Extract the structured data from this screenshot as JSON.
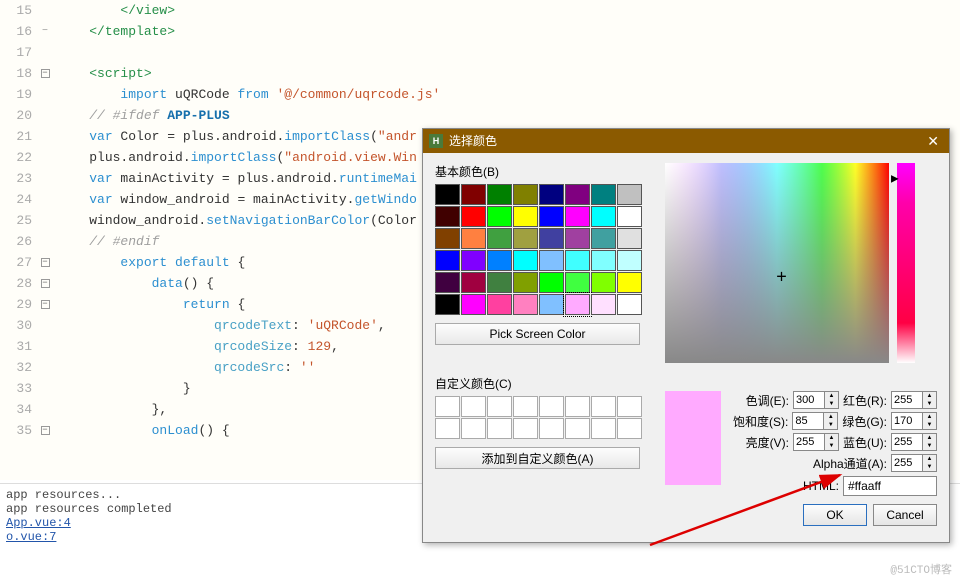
{
  "lines": [
    "15",
    "16",
    "17",
    "18",
    "19",
    "20",
    "21",
    "22",
    "23",
    "24",
    "25",
    "26",
    "27",
    "28",
    "29",
    "30",
    "31",
    "32",
    "33",
    "34",
    "35"
  ],
  "folds": [
    "",
    "−",
    "",
    "□",
    "",
    "",
    "",
    "",
    "",
    "",
    "",
    "",
    "□",
    "□",
    "□",
    "",
    "",
    "",
    "",
    "",
    "□"
  ],
  "code": {
    "l15": {
      "indent": "        ",
      "tag": "</view>"
    },
    "l16": {
      "indent": "    ",
      "tag": "</template>"
    },
    "l18": {
      "indent": "    ",
      "tag": "<script>"
    },
    "l19": {
      "indent": "        ",
      "kw": "import",
      "id": " uQRCode ",
      "kw2": "from",
      "str": " '@/common/uqrcode.js'"
    },
    "l20": {
      "indent": "    ",
      "cmt": "// #ifdef ",
      "strong": "APP-PLUS"
    },
    "l21": {
      "indent": "    ",
      "kw": "var",
      "id": " Color = plus.android.",
      "fn": "importClass",
      "paren": "(",
      "str": "\"andr"
    },
    "l22": {
      "indent": "    ",
      "id": "plus.android.",
      "fn": "importClass",
      "paren": "(",
      "str": "\"android.view.Win"
    },
    "l23": {
      "indent": "    ",
      "kw": "var",
      "id": " mainActivity = plus.android.",
      "fn": "runtimeMai"
    },
    "l24": {
      "indent": "    ",
      "kw": "var",
      "id": " window_android = mainActivity.",
      "fn": "getWindo"
    },
    "l25": {
      "indent": "    ",
      "id": "window_android.",
      "fn": "setNavigationBarColor",
      "paren": "(Color"
    },
    "l26": {
      "indent": "    ",
      "cmt": "// #endif"
    },
    "l27": {
      "indent": "        ",
      "kw": "export default",
      "op": " {"
    },
    "l28": {
      "indent": "            ",
      "fn": "data",
      "op": "() {"
    },
    "l29": {
      "indent": "                ",
      "kw": "return",
      "op": " {"
    },
    "l30": {
      "indent": "                    ",
      "prop": "qrcodeText",
      "op": ": ",
      "str": "'uQRCode'",
      "comma": ","
    },
    "l31": {
      "indent": "                    ",
      "prop": "qrcodeSize",
      "op": ": ",
      "num": "129",
      "comma": ","
    },
    "l32": {
      "indent": "                    ",
      "prop": "qrcodeSrc",
      "op": ": ",
      "str": "''"
    },
    "l33": {
      "indent": "                ",
      "op": "}"
    },
    "l34": {
      "indent": "            ",
      "op": "},"
    },
    "l35": {
      "indent": "            ",
      "fn": "onLoad",
      "op": "() {"
    }
  },
  "console": {
    "l1": "app resources...",
    "l2": "app resources completed",
    "l3": "App.vue:4",
    "l4": "o.vue:7"
  },
  "dialog": {
    "title": "选择颜色",
    "basic_label": "基本颜色(B)",
    "pick_screen": "Pick Screen Color",
    "custom_label": "自定义颜色(C)",
    "add_custom": "添加到自定义颜色(A)",
    "hue_label": "色调(E):",
    "hue_val": "300",
    "sat_label": "饱和度(S):",
    "sat_val": "85",
    "val_label": "亮度(V):",
    "val_val": "255",
    "red_label": "红色(R):",
    "red_val": "255",
    "green_label": "绿色(G):",
    "green_val": "170",
    "blue_label": "蓝色(U):",
    "blue_val": "255",
    "alpha_label": "Alpha通道(A):",
    "alpha_val": "255",
    "html_label": "HTML:",
    "html_val": "#ffaaff",
    "ok": "OK",
    "cancel": "Cancel"
  },
  "basic_colors": [
    "#000000",
    "#800000",
    "#008000",
    "#808000",
    "#000080",
    "#800080",
    "#008080",
    "#c0c0c0",
    "#400000",
    "#ff0000",
    "#00ff00",
    "#ffff00",
    "#0000ff",
    "#ff00ff",
    "#00ffff",
    "#ffffff",
    "#804000",
    "#ff8040",
    "#40a040",
    "#a0a040",
    "#4040a0",
    "#a040a0",
    "#40a0a0",
    "#e0e0e0",
    "#0000ff",
    "#8000ff",
    "#0080ff",
    "#00ffff",
    "#80c0ff",
    "#40ffff",
    "#80ffff",
    "#c0ffff",
    "#400040",
    "#a00040",
    "#408040",
    "#80a000",
    "#00ff00",
    "#40ff40",
    "#80ff00",
    "#ffff00",
    "#000000",
    "#ff00ff",
    "#ff40a0",
    "#ff80c0",
    "#80c0ff",
    "#ffaaff",
    "#ffe0ff",
    "#ffffff"
  ],
  "watermark": "@51CTO博客"
}
